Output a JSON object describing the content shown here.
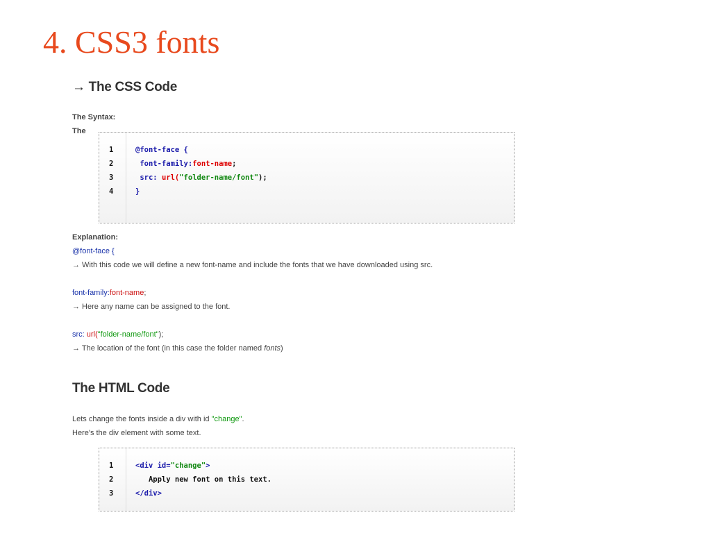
{
  "slide": {
    "title": "4. CSS3 fonts"
  },
  "css_section": {
    "heading": "→ The CSS Code",
    "syntax_label": "The Syntax:",
    "syntax_intro": "The",
    "code_lines": [
      {
        "num": "1",
        "parts": [
          {
            "text": "@font-face {",
            "color": "blue"
          }
        ]
      },
      {
        "num": "2",
        "parts": [
          {
            "text": " font-family:",
            "color": "blue"
          },
          {
            "text": "font-name",
            "color": "red"
          },
          {
            "text": ";",
            "color": "dark"
          }
        ]
      },
      {
        "num": "3",
        "parts": [
          {
            "text": " src: ",
            "color": "blue"
          },
          {
            "text": "url(",
            "color": "red"
          },
          {
            "text": "\"folder-name/font\"",
            "color": "green"
          },
          {
            "text": ");",
            "color": "dark"
          }
        ]
      },
      {
        "num": "4",
        "parts": [
          {
            "text": "}",
            "color": "blue"
          }
        ]
      }
    ],
    "explanation_label": "Explanation:",
    "explanations": [
      {
        "code": [
          {
            "text": "@font-face {",
            "color": "blue"
          }
        ],
        "desc": "→ With this code we will define a new font-name and include the fonts that we have downloaded using src."
      },
      {
        "code": [
          {
            "text": "font-family:",
            "color": "blue"
          },
          {
            "text": "font-name",
            "color": "red"
          },
          {
            "text": ";",
            "color": "dark"
          }
        ],
        "desc": "→ Here any name can be assigned to the font."
      },
      {
        "code": [
          {
            "text": "src: ",
            "color": "blue"
          },
          {
            "text": "url(",
            "color": "red"
          },
          {
            "text": "\"folder-name/font\"",
            "color": "green"
          },
          {
            "text": ");",
            "color": "dark"
          }
        ],
        "desc_before": "→ The location of the font (in this case the folder named ",
        "desc_italic": "fonts",
        "desc_after": ")"
      }
    ]
  },
  "html_section": {
    "heading": "The HTML Code",
    "intro_before": "Lets change the fonts inside a div with id ",
    "intro_id": "\"change\"",
    "intro_after": ".",
    "intro2": "Here's the div element with some text.",
    "code_lines": [
      {
        "num": "1",
        "parts": [
          {
            "text": "<div id=",
            "color": "blue"
          },
          {
            "text": "\"change\"",
            "color": "green"
          },
          {
            "text": ">",
            "color": "blue"
          }
        ]
      },
      {
        "num": "2",
        "parts": [
          {
            "text": "   Apply new font on this text.",
            "color": "dark"
          }
        ]
      },
      {
        "num": "3",
        "parts": [
          {
            "text": "</div>",
            "color": "blue"
          }
        ]
      }
    ]
  },
  "colors": {
    "title": "#e8491d",
    "keyword": "#1a33aa",
    "value": "#cc1111",
    "string": "#119911"
  }
}
